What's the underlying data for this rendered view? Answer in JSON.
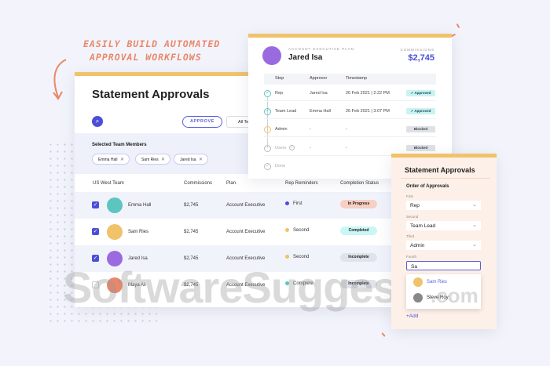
{
  "annotation": {
    "line1": "EASILY BUILD AUTOMATED",
    "line2": "APPROVAL WORKFLOWS"
  },
  "main": {
    "title": "Statement Approvals",
    "approve_label": "APPROVE",
    "team_filter": "All Teams",
    "selected_label": "Selected Team Members",
    "chips": [
      "Emma Hall",
      "Sam Ries",
      "Jared Isa"
    ],
    "columns": [
      "US West Team",
      "Commissions",
      "Plan",
      "Rep Reminders",
      "Completion Status"
    ],
    "rows": [
      {
        "checked": true,
        "name": "Emma Hall",
        "commission": "$2,745",
        "plan": "Account Executive",
        "reminder": "First",
        "reminder_color": "#4a4fd6",
        "status": "In Progress",
        "status_bg": "#f8cfc3",
        "avatar": "#5cc5c0"
      },
      {
        "checked": true,
        "name": "Sam Ries",
        "commission": "$2,745",
        "plan": "Account Executive",
        "reminder": "Second",
        "reminder_color": "#f0c26a",
        "status": "Completed",
        "status_bg": "#c9f7f5",
        "avatar": "#f0c26a"
      },
      {
        "checked": true,
        "name": "Jared Isa",
        "commission": "$2,745",
        "plan": "Account Executive",
        "reminder": "Second",
        "reminder_color": "#f0c26a",
        "status": "Incomplete",
        "status_bg": "#e1e3ea",
        "avatar": "#9a6ae0"
      },
      {
        "checked": false,
        "name": "Maya Ali",
        "commission": "$2,745",
        "plan": "Account Executive",
        "reminder": "Complete",
        "reminder_color": "#5cc5c0",
        "status": "Incomplete",
        "status_bg": "#e1e3ea",
        "avatar": "#e9876a"
      }
    ]
  },
  "workflow": {
    "plan": "ACCOUNT EXECUTIVE PLAN",
    "name": "Jared Isa",
    "commissions_label": "COMMISSIONS",
    "commissions": "$2,745",
    "columns": [
      "Step",
      "Approvor",
      "Timestamp"
    ],
    "steps": [
      {
        "step": "Rep",
        "approver": "Jared Isa",
        "time": "26 Feb 2021 | 2:22 PM",
        "status": "✓ Approved"
      },
      {
        "step": "Team Lead",
        "approver": "Emma Hall",
        "time": "26 Feb 2021 | 3:07 PM",
        "status": "✓ Approved"
      },
      {
        "step": "Admin",
        "approver": "-",
        "time": "-",
        "status": "Blocked"
      },
      {
        "step": "Users",
        "approver": "-",
        "time": "-",
        "status": "Blocked"
      },
      {
        "step": "Done"
      }
    ]
  },
  "side": {
    "title": "Statement Approvals",
    "subtitle": "Order of Approvals",
    "fields": [
      {
        "label": "First",
        "value": "Rep"
      },
      {
        "label": "Second",
        "value": "Team Lead"
      },
      {
        "label": "Third",
        "value": "Admin"
      },
      {
        "label": "Fourth",
        "value": "Sa"
      }
    ],
    "suggestions": [
      "Sam Ries",
      "Steve Roy"
    ],
    "add_label": "+Add"
  },
  "watermark": {
    "main": "SoftwareSuggest",
    "suffix": ".com"
  }
}
